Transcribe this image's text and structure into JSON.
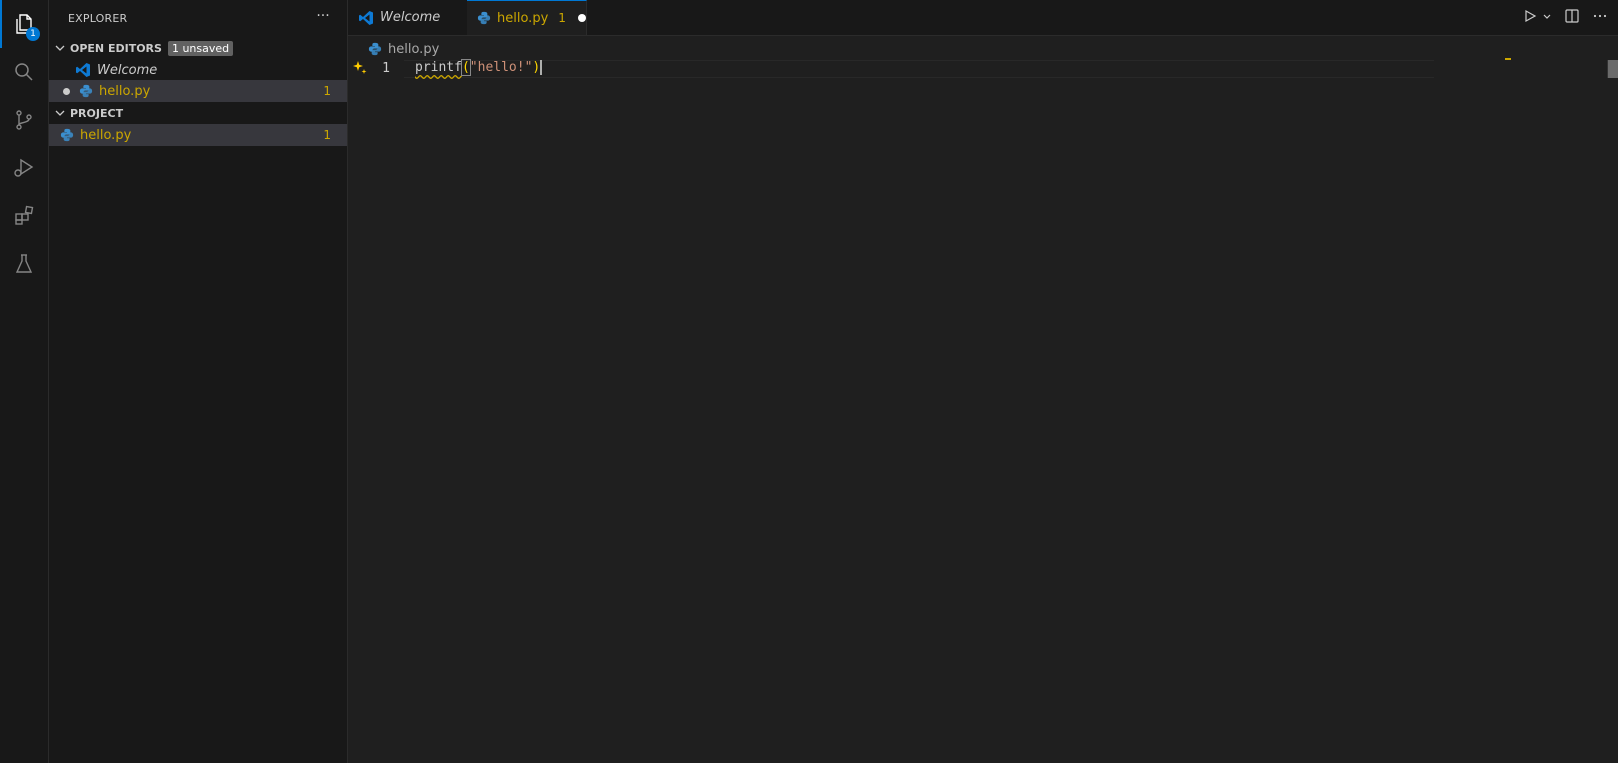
{
  "activity": {
    "items": [
      {
        "name": "explorer-icon",
        "badge": "1"
      },
      {
        "name": "search-icon"
      },
      {
        "name": "source-control-icon"
      },
      {
        "name": "run-debug-icon"
      },
      {
        "name": "extensions-icon"
      },
      {
        "name": "testing-icon"
      }
    ]
  },
  "sidebar": {
    "title": "EXPLORER",
    "more": "···",
    "open_editors": {
      "title": "OPEN EDITORS",
      "unsaved_badge": "1 unsaved",
      "items": [
        {
          "label": "Welcome"
        },
        {
          "label": "hello.py",
          "count": "1"
        }
      ]
    },
    "project": {
      "title": "PROJECT",
      "items": [
        {
          "label": "hello.py",
          "count": "1"
        }
      ]
    }
  },
  "tabs": [
    {
      "label": "Welcome"
    },
    {
      "label": "hello.py",
      "count": "1"
    }
  ],
  "breadcrumb": {
    "file": "hello.py"
  },
  "editor": {
    "line_number": "1",
    "code": {
      "fn": "printf",
      "open": "(",
      "str": "\"hello!\"",
      "close": ")"
    }
  },
  "colors": {
    "accent": "#0078d4",
    "warning": "#cca700",
    "string": "#ce9178"
  }
}
